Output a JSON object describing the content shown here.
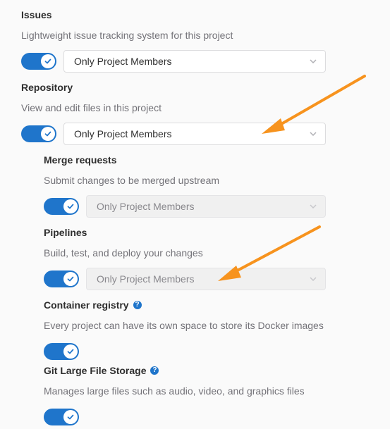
{
  "sections": {
    "issues": {
      "title": "Issues",
      "description": "Lightweight issue tracking system for this project",
      "toggle_on": true,
      "select_value": "Only Project Members"
    },
    "repository": {
      "title": "Repository",
      "description": "View and edit files in this project",
      "toggle_on": true,
      "select_value": "Only Project Members"
    },
    "merge_requests": {
      "title": "Merge requests",
      "description": "Submit changes to be merged upstream",
      "toggle_on": true,
      "select_value": "Only Project Members"
    },
    "pipelines": {
      "title": "Pipelines",
      "description": "Build, test, and deploy your changes",
      "toggle_on": true,
      "select_value": "Only Project Members"
    },
    "container_registry": {
      "title": "Container registry",
      "help_glyph": "?",
      "description": "Every project can have its own space to store its Docker images",
      "toggle_on": true
    },
    "git_lfs": {
      "title": "Git Large File Storage",
      "help_glyph": "?",
      "description": "Manages large files such as audio, video, and graphics files",
      "toggle_on": true
    }
  },
  "colors": {
    "toggle_on": "#1f75cb",
    "annotation_arrow": "#f7931e"
  }
}
